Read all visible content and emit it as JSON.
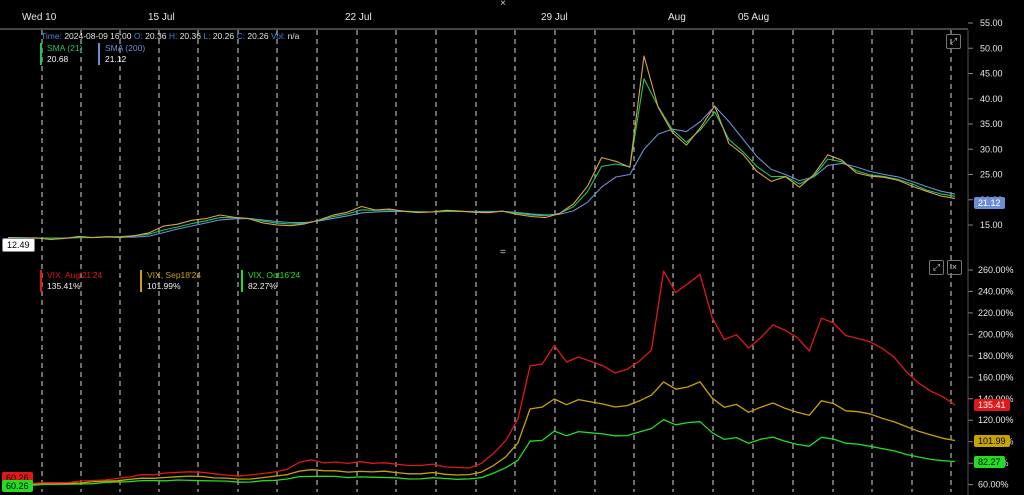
{
  "header": {
    "close_glyph": "×",
    "info_line": {
      "time_label": "Time:",
      "time": "2024-08-09 16:00",
      "open_label": "O:",
      "open": "20.36",
      "high_label": "H:",
      "high": "20.36",
      "low_label": "L:",
      "low": "20.26",
      "close_label": "C:",
      "close": "20.26",
      "vol_label": "Vol:",
      "vol": "n/a"
    }
  },
  "top_pane": {
    "legend": [
      {
        "name": "SMA (21)",
        "value": "20.68",
        "color": "#22c55e"
      },
      {
        "name": "SMA (200)",
        "value": "21.12",
        "color": "#6b8fd6"
      }
    ],
    "last_tag": "21.12",
    "left_tag": "12.49",
    "expand_icon": "⤢"
  },
  "bottom_pane": {
    "legend": [
      {
        "name": "VIX, Aug'21'24",
        "value": "135.41%",
        "color": "#e01818"
      },
      {
        "name": "VIX, Sep18'24",
        "value": "101.99%",
        "color": "#c8a400"
      },
      {
        "name": "VIX, Oct16'24",
        "value": "82.27%",
        "color": "#22dd22"
      }
    ],
    "tags": [
      "135.41",
      "101.99",
      "82.27"
    ],
    "left_tags": [
      "60.26",
      "60.26"
    ],
    "expand_icon": "⤢",
    "close_icon": "×"
  },
  "divider_glyph": "=",
  "chart_data": [
    {
      "type": "line",
      "x_labels": [
        "Wed 10",
        "15 Jul",
        "22 Jul",
        "29 Jul",
        "Aug",
        "05 Aug"
      ],
      "ylim": [
        10,
        55
      ],
      "y_ticks": [
        "55.00",
        "50.00",
        "45.00",
        "40.00",
        "35.00",
        "30.00",
        "25.00",
        "20.00",
        "15.00"
      ],
      "grid": true,
      "series": [
        {
          "name": "VIX",
          "color": "#d9a441",
          "values": [
            12.5,
            12.4,
            12.6,
            12.3,
            12.5,
            12.9,
            12.6,
            12.7,
            12.5,
            12.8,
            13.3,
            14.6,
            15.0,
            15.8,
            16.2,
            17.0,
            16.6,
            16.4,
            15.6,
            15.2,
            15.0,
            15.3,
            16.0,
            16.9,
            17.4,
            18.5,
            17.8,
            18.0,
            17.6,
            17.4,
            17.6,
            18.0,
            17.9,
            17.7,
            17.6,
            17.9,
            17.2,
            16.7,
            16.4,
            17.1,
            19.0,
            22.5,
            28.2,
            27.5,
            26.4,
            48.5,
            38.4,
            33.5,
            31.0,
            34.5,
            38.7,
            31.2,
            29.0,
            25.5,
            23.5,
            24.4,
            22.3,
            24.8,
            28.8,
            27.8,
            25.4,
            24.8,
            24.6,
            24.0,
            22.8,
            21.8,
            20.8,
            20.26
          ]
        },
        {
          "name": "SMA (21)",
          "color": "#22c55e",
          "values": [
            12.5,
            12.5,
            12.5,
            12.5,
            12.5,
            12.6,
            12.6,
            12.7,
            12.7,
            12.8,
            13.1,
            13.9,
            14.5,
            15.2,
            15.8,
            16.5,
            16.5,
            16.4,
            15.9,
            15.5,
            15.3,
            15.4,
            15.9,
            16.6,
            17.1,
            17.9,
            17.8,
            17.9,
            17.7,
            17.6,
            17.6,
            17.8,
            17.8,
            17.7,
            17.7,
            17.8,
            17.4,
            17.0,
            16.8,
            17.2,
            18.5,
            21.5,
            26.5,
            27.0,
            26.5,
            44.0,
            38.5,
            34.0,
            31.5,
            34.0,
            37.5,
            32.0,
            29.5,
            26.5,
            24.5,
            24.5,
            23.0,
            24.5,
            28.0,
            27.5,
            25.8,
            25.0,
            24.7,
            24.1,
            23.2,
            22.0,
            21.2,
            20.68
          ]
        },
        {
          "name": "SMA (200)",
          "color": "#6b8fd6",
          "values": [
            12.5,
            12.5,
            12.4,
            12.4,
            12.4,
            12.5,
            12.5,
            12.6,
            12.6,
            12.6,
            12.8,
            13.5,
            14.2,
            14.8,
            15.4,
            16.0,
            16.2,
            16.3,
            16.0,
            15.7,
            15.5,
            15.5,
            15.8,
            16.3,
            16.8,
            17.4,
            17.6,
            17.7,
            17.7,
            17.6,
            17.6,
            17.7,
            17.7,
            17.7,
            17.7,
            17.7,
            17.5,
            17.2,
            17.0,
            17.1,
            17.8,
            19.5,
            22.5,
            24.5,
            25.0,
            30.0,
            33.0,
            34.0,
            33.5,
            35.5,
            38.5,
            35.5,
            32.0,
            28.5,
            26.0,
            25.0,
            23.8,
            24.5,
            26.8,
            27.2,
            26.5,
            25.6,
            25.0,
            24.5,
            23.6,
            22.6,
            21.7,
            21.12
          ]
        }
      ]
    },
    {
      "type": "line",
      "x_labels": [
        "Wed 10",
        "15 Jul",
        "22 Jul",
        "29 Jul",
        "Aug",
        "05 Aug"
      ],
      "ylim": [
        60,
        270
      ],
      "y_ticks": [
        "260.00%",
        "240.00%",
        "220.00%",
        "200.00%",
        "180.00%",
        "160.00%",
        "140.00%",
        "120.00%",
        "100.00%",
        "80.00%",
        "60.00%"
      ],
      "grid": true,
      "series": [
        {
          "name": "VIX, Aug'21'24",
          "color": "#e01818",
          "values": [
            62,
            62,
            62,
            63,
            63,
            63,
            64,
            64,
            64,
            65,
            66,
            68,
            68,
            70,
            71,
            72,
            72,
            71,
            70,
            69,
            70,
            71,
            72,
            74,
            80,
            82,
            79,
            80,
            79,
            81,
            80,
            81,
            80,
            79,
            79,
            80,
            77,
            76,
            75,
            79,
            88,
            100,
            120,
            170,
            172,
            190,
            175,
            180,
            176,
            172,
            165,
            168,
            175,
            185,
            258,
            238,
            246,
            255,
            215,
            195,
            200,
            188,
            198,
            210,
            205,
            198,
            185,
            215,
            210,
            198,
            195,
            192,
            186,
            178,
            165,
            155,
            148,
            143,
            135.41
          ]
        },
        {
          "name": "VIX, Sep18'24",
          "color": "#c8a400",
          "values": [
            61,
            61,
            61,
            62,
            62,
            62,
            62,
            63,
            63,
            63,
            64,
            65,
            65,
            66,
            67,
            68,
            68,
            67,
            67,
            66,
            66,
            67,
            68,
            69,
            72,
            73,
            72,
            72,
            71,
            72,
            72,
            73,
            72,
            71,
            71,
            72,
            70,
            69,
            69,
            71,
            77,
            85,
            98,
            130,
            132,
            140,
            135,
            140,
            138,
            136,
            133,
            134,
            138,
            143,
            155,
            148,
            150,
            155,
            140,
            132,
            135,
            128,
            133,
            137,
            132,
            128,
            125,
            138,
            135,
            128,
            127,
            125,
            121,
            118,
            114,
            110,
            107,
            104,
            101.99
          ]
        },
        {
          "name": "VIX, Oct16'24",
          "color": "#22dd22",
          "values": [
            60,
            60,
            60,
            61,
            61,
            61,
            61,
            61,
            62,
            62,
            62,
            63,
            63,
            63,
            64,
            64,
            64,
            64,
            64,
            63,
            63,
            64,
            64,
            65,
            67,
            67,
            67,
            67,
            66,
            67,
            67,
            67,
            67,
            66,
            66,
            67,
            66,
            65,
            65,
            66,
            70,
            75,
            82,
            100,
            101,
            110,
            106,
            110,
            109,
            108,
            106,
            106,
            109,
            112,
            120,
            115,
            117,
            118,
            108,
            102,
            104,
            99,
            103,
            105,
            101,
            98,
            96,
            104,
            102,
            98,
            97,
            95,
            93,
            91,
            88,
            86,
            84,
            83,
            82.27
          ]
        }
      ]
    }
  ]
}
